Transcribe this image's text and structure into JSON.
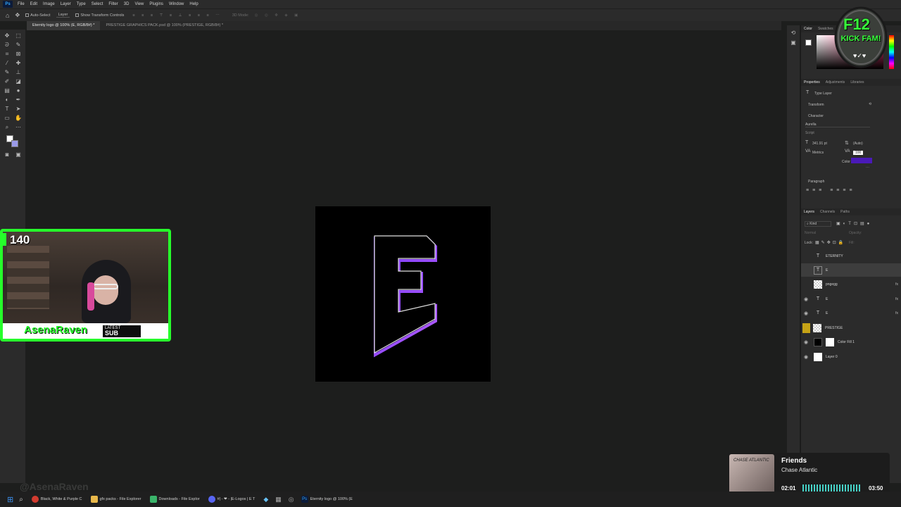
{
  "menubar": {
    "items": [
      "File",
      "Edit",
      "Image",
      "Layer",
      "Type",
      "Select",
      "Filter",
      "3D",
      "View",
      "Plugins",
      "Window",
      "Help"
    ]
  },
  "options_bar": {
    "auto_select": "Auto-Select",
    "target": "Layer",
    "show_transform": "Show Transform Controls",
    "mode_3d": "3D Mode:"
  },
  "doc_tabs": [
    {
      "label": "Eternity logo @ 100% (E, RGB/8#) *",
      "active": true
    },
    {
      "label": "PRESTIGE GRAPHICS PACK.psd @ 100% (PRESTIGE, RGB/8#) *",
      "active": false
    }
  ],
  "color_panel": {
    "tabs": [
      "Color",
      "Swatches"
    ]
  },
  "properties": {
    "tabs": [
      "Properties",
      "Adjustments",
      "Libraries"
    ],
    "layer_type": "Type Layer",
    "transform": "Transform",
    "character": "Character",
    "font_family": "Aurella",
    "font_style": "Script",
    "font_size": "341.91 pt",
    "leading": "(Auto)",
    "kerning": "Metrics",
    "tracking": "100",
    "color_label": "Color",
    "text_color": "#4a1ab8",
    "paragraph": "Paragraph"
  },
  "layers": {
    "tabs": [
      "Layers",
      "Channels",
      "Paths"
    ],
    "filter": "Kind",
    "blend": "Normal",
    "opacity": "Opacity:",
    "lock": "Lock:",
    "fill": "Fill:",
    "rows": [
      {
        "name": "ETERNITY",
        "kind": "text",
        "visible": false,
        "selected": false,
        "fx": false
      },
      {
        "name": "E",
        "kind": "text",
        "visible": false,
        "selected": true,
        "fx": false
      },
      {
        "name": "pngegg",
        "kind": "image",
        "visible": false,
        "selected": false,
        "fx": true
      },
      {
        "name": "E",
        "kind": "text",
        "visible": true,
        "selected": false,
        "fx": true
      },
      {
        "name": "E",
        "kind": "text",
        "visible": true,
        "selected": false,
        "fx": true
      },
      {
        "name": "PRESTIGE",
        "kind": "image",
        "visible": false,
        "selected": false,
        "fx": false
      },
      {
        "name": "Color Fill 1",
        "kind": "fill",
        "visible": true,
        "selected": false,
        "fx": false
      },
      {
        "name": "Layer 0",
        "kind": "white",
        "visible": true,
        "selected": false,
        "fx": false
      }
    ]
  },
  "canvas": {
    "letter": "E"
  },
  "webcam": {
    "count": "140",
    "subscriber": "AsenaRaven",
    "latest": "LATEST",
    "sub": "SUB",
    "watermark": "@AsenaRaven"
  },
  "badge": {
    "line1": "F12",
    "line2": "KICK FAM!"
  },
  "music": {
    "title": "Friends",
    "artist": "Chase Atlantic",
    "album_text": "CHASE ATLANTIC",
    "elapsed": "02:01",
    "total": "03:50",
    "progress": 0.53
  },
  "taskbar": {
    "items": [
      {
        "label": "Black, White & Purple C",
        "icon": "chrome-icon",
        "color": "#d23b2f"
      },
      {
        "label": "gfx packs - File Explorer",
        "icon": "folder-icon",
        "color": "#e8b84a"
      },
      {
        "label": "Downloads - File Explor",
        "icon": "download-icon",
        "color": "#3ab46a"
      },
      {
        "label": "#| - ❤ - |E-Logos | E T",
        "icon": "discord-icon",
        "color": "#5865f2"
      },
      {
        "label": "Eternity logo @ 100% (E",
        "icon": "photoshop-icon",
        "color": "#31a8ff"
      }
    ]
  }
}
